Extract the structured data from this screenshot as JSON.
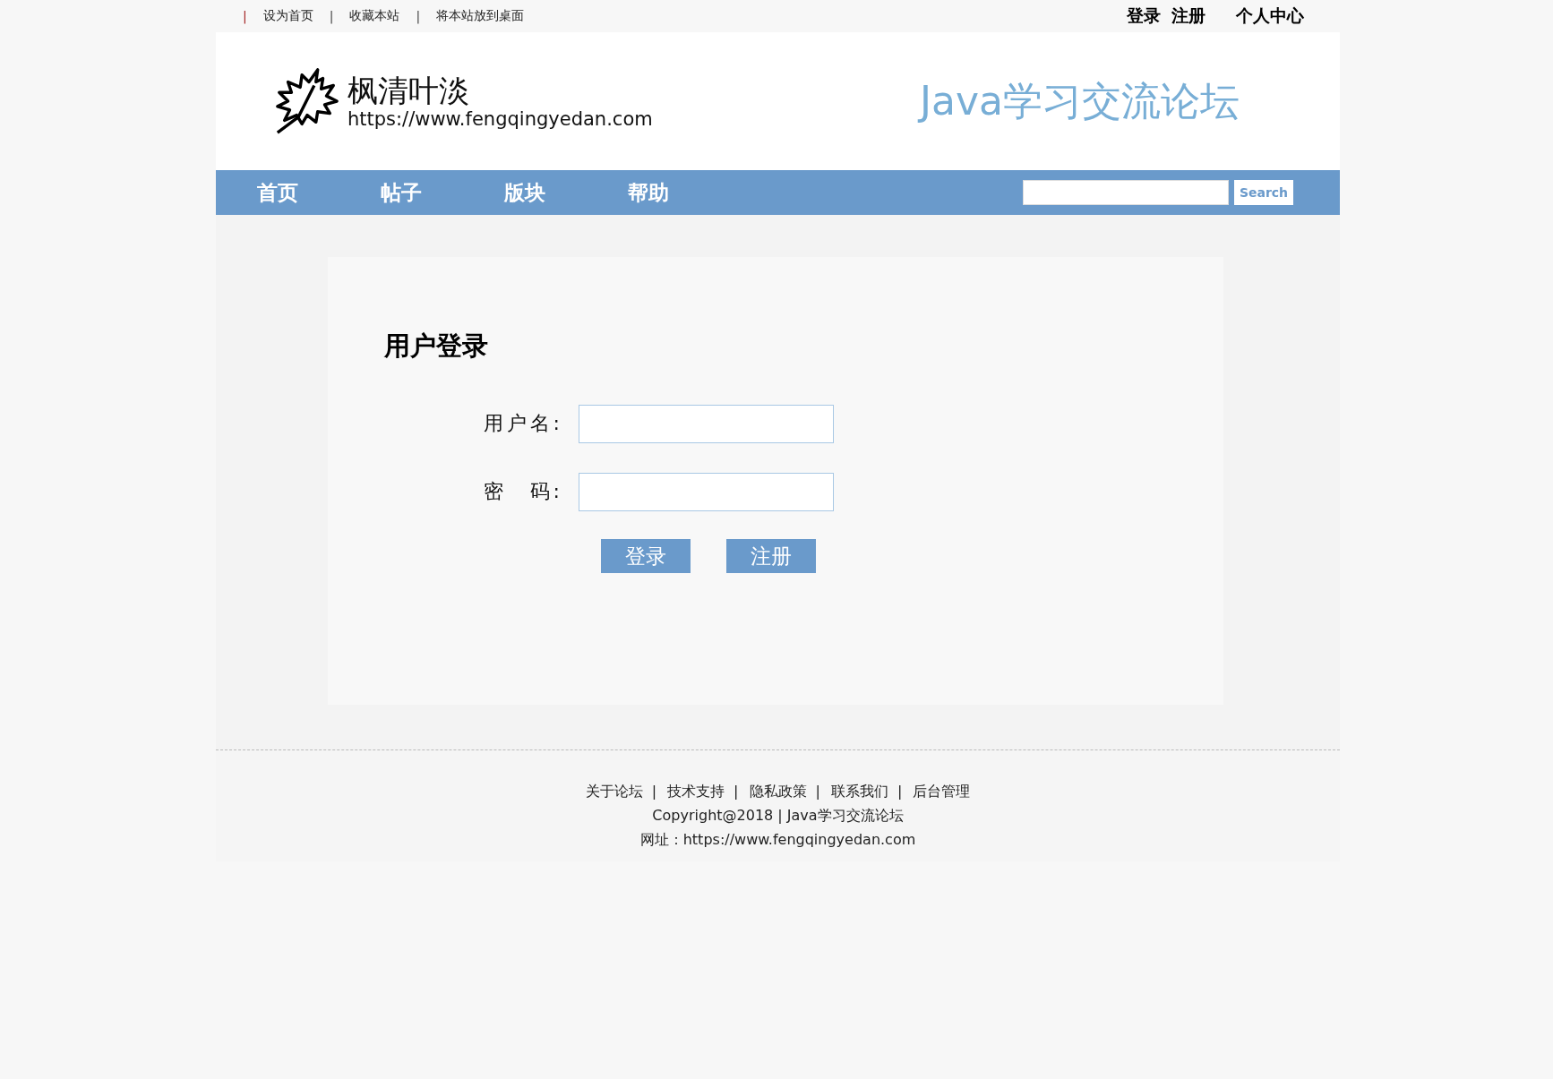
{
  "top_bar": {
    "links": [
      {
        "separator": "|",
        "label": "设为首页"
      },
      {
        "separator": "|",
        "label": "收藏本站"
      },
      {
        "separator": "|",
        "label": "将本站放到桌面"
      }
    ],
    "account_links": [
      "登录",
      "注册",
      "个人中心"
    ]
  },
  "header": {
    "site_name": "枫清叶淡",
    "site_url": "https://www.fengqingyedan.com",
    "slogan": "Java学习交流论坛"
  },
  "nav": {
    "items": [
      {
        "label": "首页"
      },
      {
        "label": "帖子"
      },
      {
        "label": "版块"
      },
      {
        "label": "帮助"
      }
    ],
    "search_button": "Search"
  },
  "login": {
    "title": "用户登录",
    "fields": [
      {
        "label": "用户名:"
      },
      {
        "label": "密　码:"
      }
    ],
    "buttons": [
      "登录",
      "注册"
    ]
  },
  "footer": {
    "links": [
      {
        "label": "关于论坛",
        "separator": "|"
      },
      {
        "label": "技术支持",
        "separator": "|"
      },
      {
        "label": "隐私政策",
        "separator": "|"
      },
      {
        "label": "联系我们",
        "separator": "|"
      },
      {
        "label": "后台管理"
      }
    ],
    "copyright": "Copyright@2018 | Java学习交流论坛",
    "address": "网址：https://www.fengqingyedan.com"
  }
}
